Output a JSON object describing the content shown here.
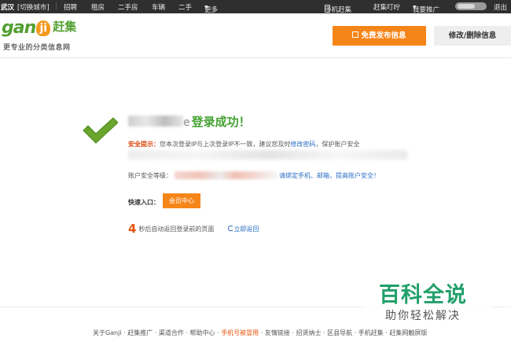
{
  "topbar": {
    "city": "武汉",
    "switch_city": "[切换城市]",
    "nav": [
      "招聘",
      "租房",
      "二手房",
      "车辆",
      "二手",
      "更多"
    ],
    "mobile": "手机赶集",
    "ganji_time": "赶集叮咛",
    "promote": "我要推广",
    "logout": "退出"
  },
  "header": {
    "logo_latin": "gan",
    "logo_circle": "ji",
    "logo_cn": "赶集",
    "slogan": "更专业的分类信息网",
    "post_button": "免费发布信息",
    "edit_button": "修改/删除信息"
  },
  "main": {
    "username_suffix": "e",
    "success_text": "登录成功！",
    "tip_label": "安全提示：",
    "tip_text": "您本次登录IP与上次登录IP不一致，建议您及时",
    "tip_link": "修改密码",
    "tip_text_after": "，保护账户安全",
    "security_label": "账户安全等级：",
    "security_link": "请绑定手机、邮箱，提高账户安全！",
    "quick_label": "快速入口：",
    "member_button": "会员中心",
    "countdown_value": "4",
    "countdown_text": "秒后自动返回登录前的页面",
    "back_link": "立即返回"
  },
  "footer": {
    "items": [
      "关于Ganji",
      "赶集推广",
      "渠道合作",
      "帮助中心",
      "手机号被冒用",
      "友情链接",
      "招贤纳士",
      "区县导航",
      "手机赶集",
      "赶集网触屏版"
    ]
  },
  "watermark": {
    "title": "百科全说",
    "subtitle": "助你轻松解决"
  },
  "colors": {
    "accent_orange": "#f68519",
    "brand_green": "#52a032",
    "link_blue": "#2a6dc4",
    "topbar_bg": "#2f2f2f"
  }
}
